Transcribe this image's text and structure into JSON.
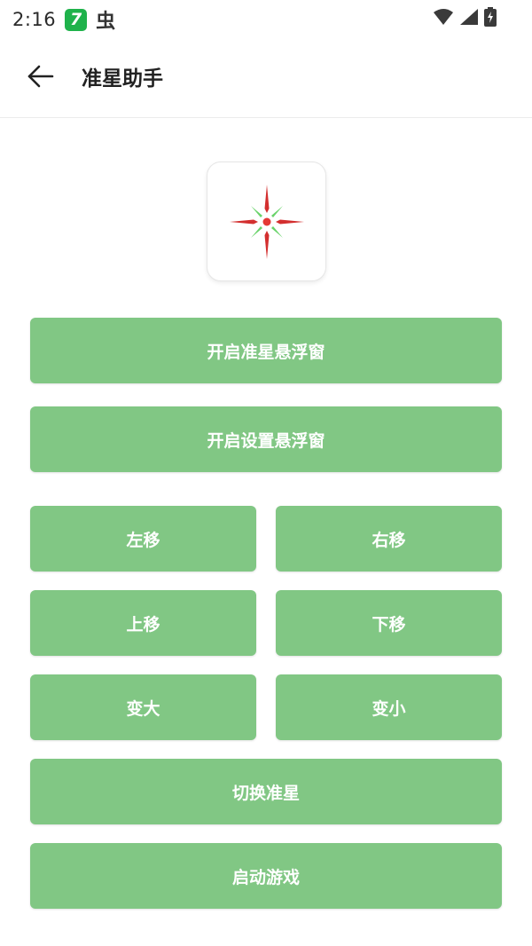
{
  "status_bar": {
    "time": "2:16",
    "app_badge": "7",
    "bug_glyph": "虫",
    "icons": [
      "wifi-icon",
      "signal-icon",
      "battery-charging-icon"
    ]
  },
  "app_bar": {
    "title": "准星助手",
    "back_icon": "arrow-left-icon"
  },
  "preview": {
    "icon": "crosshair-icon",
    "colors": {
      "outer": "#d32f2f",
      "inner": "#69d36a",
      "center": "#e53935"
    }
  },
  "buttons": {
    "open_crosshair_overlay": "开启准星悬浮窗",
    "open_settings_overlay": "开启设置悬浮窗",
    "move_left": "左移",
    "move_right": "右移",
    "move_up": "上移",
    "move_down": "下移",
    "enlarge": "变大",
    "shrink": "变小",
    "switch_crosshair": "切换准星",
    "launch_game": "启动游戏"
  },
  "theme": {
    "button_color": "#81c784",
    "button_text_color": "#ffffff"
  }
}
